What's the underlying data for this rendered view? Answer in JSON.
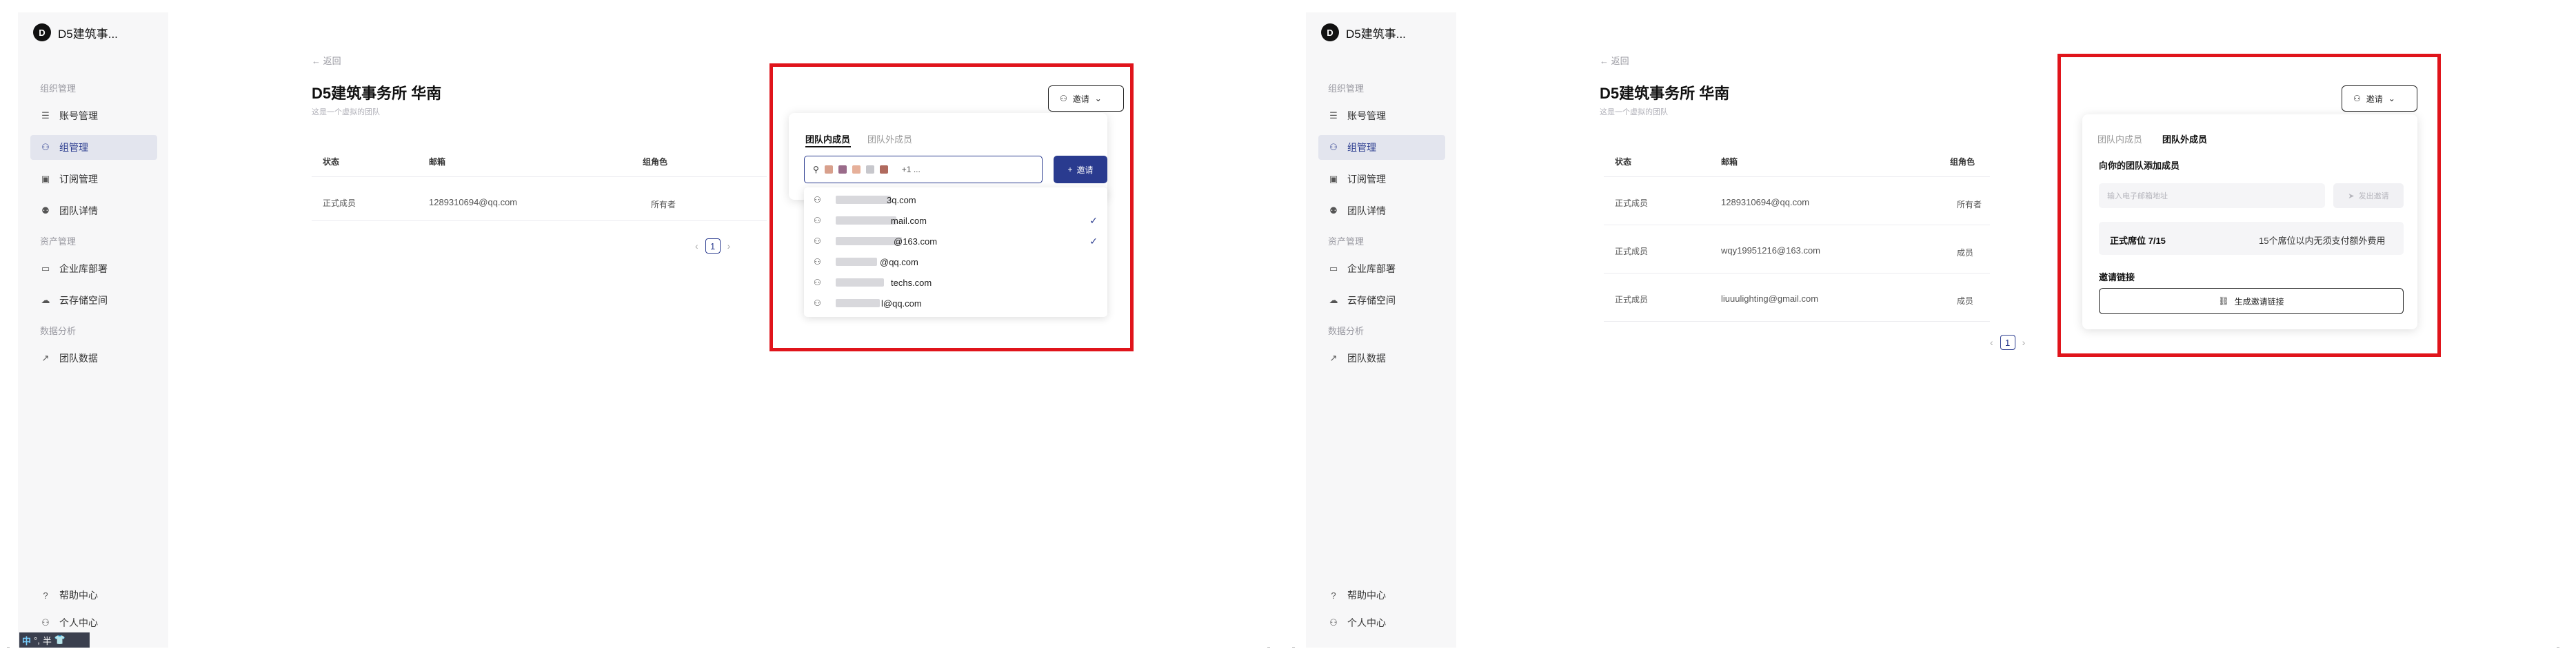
{
  "sidebar": {
    "brand_logo": "D",
    "brand_name": "D5建筑事...",
    "section_org": "组织管理",
    "section_assets": "资产管理",
    "section_analytics": "数据分析",
    "items": [
      {
        "label": "账号管理",
        "icon": "list-icon"
      },
      {
        "label": "组管理",
        "icon": "users-icon"
      },
      {
        "label": "订阅管理",
        "icon": "card-icon"
      },
      {
        "label": "团队详情",
        "icon": "team-icon"
      },
      {
        "label": "企业库部署",
        "icon": "folder-icon"
      },
      {
        "label": "云存储空间",
        "icon": "cloud-icon"
      },
      {
        "label": "团队数据",
        "icon": "trend-icon"
      }
    ],
    "help": "帮助中心",
    "profile": "个人中心"
  },
  "main": {
    "back": "← 返回",
    "title": "D5建筑事务所 华南",
    "subtitle": "这是一个虚拟的团队",
    "columns": [
      "状态",
      "邮箱",
      "组角色"
    ],
    "rows_left": [
      {
        "status": "正式成员",
        "email": "1289310694@qq.com",
        "role": "所有者"
      }
    ],
    "rows_right": [
      {
        "status": "正式成员",
        "email": "1289310694@qq.com",
        "role": "所有者"
      },
      {
        "status": "正式成员",
        "email": "wqy19951216@163.com",
        "role": "成员"
      },
      {
        "status": "正式成员",
        "email": "liuuulighting@gmail.com",
        "role": "成员"
      }
    ],
    "pager": {
      "prev": "‹",
      "page": "1",
      "next": "›"
    }
  },
  "invite_button": {
    "label": "邀请",
    "chevron": "⌄"
  },
  "popover_left": {
    "tab_internal": "团队内成员",
    "tab_external": "团队外成员",
    "tag_count": "+1 ...",
    "invite_label": "邀请",
    "suggestions": [
      {
        "text": "3q.com",
        "checked": false
      },
      {
        "text": "mail.com",
        "checked": true
      },
      {
        "text": "@163.com",
        "checked": true
      },
      {
        "text": "@qq.com",
        "checked": false
      },
      {
        "text": "techs.com",
        "checked": false
      },
      {
        "text": "l@qq.com",
        "checked": false
      }
    ]
  },
  "popover_right": {
    "tab_internal": "团队内成员",
    "tab_external": "团队外成员",
    "add_heading": "向你的团队添加成员",
    "email_placeholder": "输入电子邮箱地址",
    "send_label": "发出邀请",
    "seats_label": "正式席位 7/15",
    "seats_note": "15个席位以内无须支付额外费用",
    "link_heading": "邀请链接",
    "link_button": "生成邀请链接"
  },
  "ime": {
    "mode": "中",
    "punct": "°,",
    "width": "半"
  },
  "colors": {
    "accent": "#2a3b8f",
    "highlight_box": "#e0141b",
    "active_nav": "#e3e5ee"
  }
}
